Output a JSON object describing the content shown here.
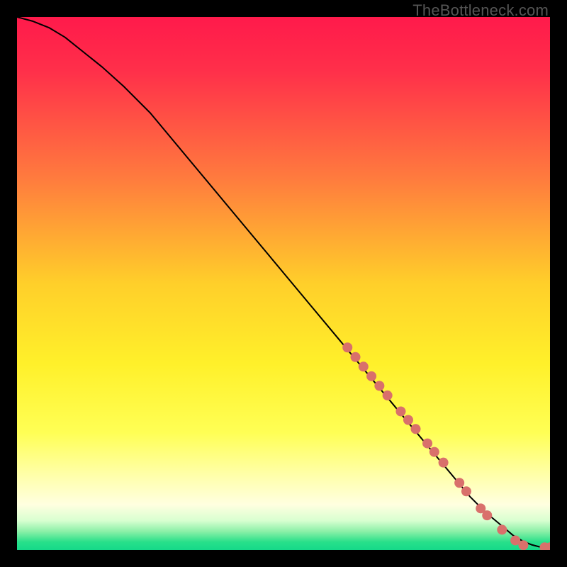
{
  "watermark": "TheBottleneck.com",
  "chart_data": {
    "type": "line",
    "title": "",
    "xlabel": "",
    "ylabel": "",
    "xlim": [
      0,
      100
    ],
    "ylim": [
      0,
      100
    ],
    "background_gradient": {
      "stops": [
        {
          "offset": 0.0,
          "color": "#ff1a4b"
        },
        {
          "offset": 0.1,
          "color": "#ff2f4a"
        },
        {
          "offset": 0.3,
          "color": "#ff7a3e"
        },
        {
          "offset": 0.5,
          "color": "#ffcf2a"
        },
        {
          "offset": 0.65,
          "color": "#fff02a"
        },
        {
          "offset": 0.78,
          "color": "#ffff55"
        },
        {
          "offset": 0.86,
          "color": "#ffffaa"
        },
        {
          "offset": 0.915,
          "color": "#ffffe0"
        },
        {
          "offset": 0.945,
          "color": "#d8ffd0"
        },
        {
          "offset": 0.965,
          "color": "#8cf0a8"
        },
        {
          "offset": 0.985,
          "color": "#28e08a"
        },
        {
          "offset": 1.0,
          "color": "#15d989"
        }
      ]
    },
    "curve": {
      "x": [
        0,
        3,
        6,
        9,
        12,
        16,
        20,
        25,
        30,
        35,
        40,
        45,
        50,
        55,
        60,
        65,
        70,
        75,
        80,
        85,
        88,
        91,
        93,
        95,
        96.5,
        98,
        100
      ],
      "y": [
        100,
        99.2,
        98.0,
        96.2,
        93.8,
        90.6,
        87.0,
        82.0,
        76.0,
        70.0,
        64.0,
        58.0,
        52.0,
        46.0,
        40.0,
        34.0,
        28.0,
        22.0,
        16.0,
        10.0,
        7.0,
        4.5,
        2.8,
        1.6,
        1.0,
        0.6,
        0.5
      ]
    },
    "highlight_points": {
      "color": "#d9706b",
      "radius": 7,
      "points": [
        {
          "x": 62.0,
          "y": 38.0
        },
        {
          "x": 63.5,
          "y": 36.2
        },
        {
          "x": 65.0,
          "y": 34.4
        },
        {
          "x": 66.5,
          "y": 32.6
        },
        {
          "x": 68.0,
          "y": 30.8
        },
        {
          "x": 69.5,
          "y": 29.0
        },
        {
          "x": 72.0,
          "y": 26.0
        },
        {
          "x": 73.4,
          "y": 24.4
        },
        {
          "x": 74.8,
          "y": 22.7
        },
        {
          "x": 77.0,
          "y": 20.0
        },
        {
          "x": 78.3,
          "y": 18.4
        },
        {
          "x": 80.0,
          "y": 16.4
        },
        {
          "x": 83.0,
          "y": 12.6
        },
        {
          "x": 84.3,
          "y": 11.0
        },
        {
          "x": 87.0,
          "y": 7.8
        },
        {
          "x": 88.2,
          "y": 6.5
        },
        {
          "x": 91.0,
          "y": 3.8
        },
        {
          "x": 93.5,
          "y": 1.8
        },
        {
          "x": 95.0,
          "y": 0.9
        },
        {
          "x": 99.0,
          "y": 0.5
        },
        {
          "x": 100,
          "y": 0.5
        }
      ]
    }
  }
}
